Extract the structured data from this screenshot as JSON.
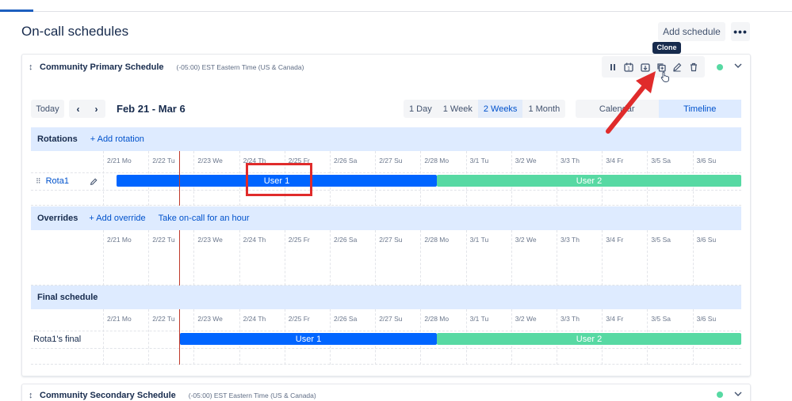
{
  "page": {
    "title": "On-call schedules",
    "add_schedule": "Add schedule",
    "more": "•••"
  },
  "primary": {
    "name": "Community Primary Schedule",
    "timezone": "(-05:00) EST Eastern Time (US & Canada)"
  },
  "secondary": {
    "name": "Community Secondary Schedule",
    "timezone": "(-05:00) EST Eastern Time (US & Canada)"
  },
  "toolbar": {
    "icons": [
      "pause-icon",
      "calendar-today-icon",
      "export-icon",
      "clone-icon",
      "edit-icon",
      "delete-icon"
    ],
    "tooltip": "Clone"
  },
  "nav": {
    "today": "Today",
    "prev": "‹",
    "next": "›",
    "date_range": "Feb 21 - Mar 6"
  },
  "ranges": [
    {
      "label": "1 Day",
      "active": false
    },
    {
      "label": "1 Week",
      "active": false
    },
    {
      "label": "2 Weeks",
      "active": true
    },
    {
      "label": "1 Month",
      "active": false
    }
  ],
  "views": [
    {
      "label": "Calendar",
      "active": false
    },
    {
      "label": "Timeline",
      "active": true
    }
  ],
  "days": [
    "2/21 Mo",
    "2/22 Tu",
    "2/23 We",
    "2/24 Th",
    "2/25 Fr",
    "2/26 Sa",
    "2/27 Su",
    "2/28 Mo",
    "3/1 Tu",
    "3/2 We",
    "3/3 Th",
    "3/4 Fr",
    "3/5 Sa",
    "3/6 Su"
  ],
  "rotations": {
    "title": "Rotations",
    "add_link": "+ Add rotation",
    "row_name": "Rota1",
    "bars": [
      {
        "user": "User 1",
        "color": "#0065ff",
        "start_day": "2/21 Mo",
        "end_day": "2/28 Mo"
      },
      {
        "user": "User 2",
        "color": "#57d9a3",
        "start_day": "2/28 Mo",
        "end_day": "3/6 Su"
      }
    ]
  },
  "overrides": {
    "title": "Overrides",
    "add_link": "+ Add override",
    "take_link": "Take on-call for an hour"
  },
  "final": {
    "title": "Final schedule",
    "row_name": "Rota1's final",
    "bars": [
      {
        "user": "User 1",
        "color": "#0065ff"
      },
      {
        "user": "User 2",
        "color": "#57d9a3"
      }
    ]
  },
  "colors": {
    "accent": "#0052cc",
    "band": "#deebff",
    "user1": "#0065ff",
    "user2": "#57d9a3",
    "now_line": "#c0392b",
    "annotation": "#e02b2b"
  }
}
